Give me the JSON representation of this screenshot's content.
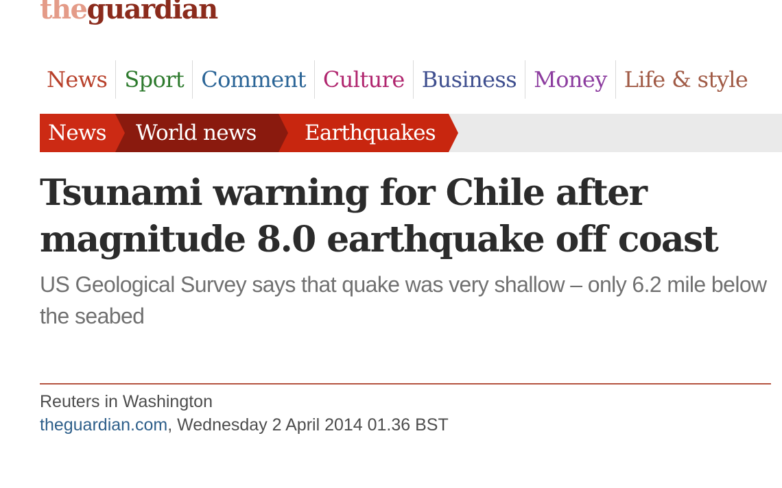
{
  "masthead": {
    "the": "the",
    "guardian": "guardian"
  },
  "section_nav": [
    {
      "label": "News",
      "color": "#b8402a"
    },
    {
      "label": "Sport",
      "color": "#2d7a2d"
    },
    {
      "label": "Comment",
      "color": "#2a6496"
    },
    {
      "label": "Culture",
      "color": "#b0256e"
    },
    {
      "label": "Business",
      "color": "#3f4f8f"
    },
    {
      "label": "Money",
      "color": "#8c3c9f"
    },
    {
      "label": "Life & style",
      "color": "#a05a45"
    }
  ],
  "breadcrumb": [
    "News",
    "World news",
    "Earthquakes"
  ],
  "article": {
    "headline_line1": "Tsunami warning for Chile after",
    "headline_line2": "magnitude 8.0 earthquake off coast",
    "standfirst": "US Geological Survey says that quake was very shallow – only 6.2 mile below the seabed",
    "byline": "Reuters in Washington",
    "site": "theguardian.com",
    "date": ", Wednesday 2 April 2014 01.36 BST"
  },
  "colors": {
    "brand_dark": "#8b2b1c",
    "brand_light": "#e49b88",
    "breadcrumb_red": "#cc2a14",
    "breadcrumb_dark": "#8a1a0e",
    "divider": "#b4533f"
  }
}
